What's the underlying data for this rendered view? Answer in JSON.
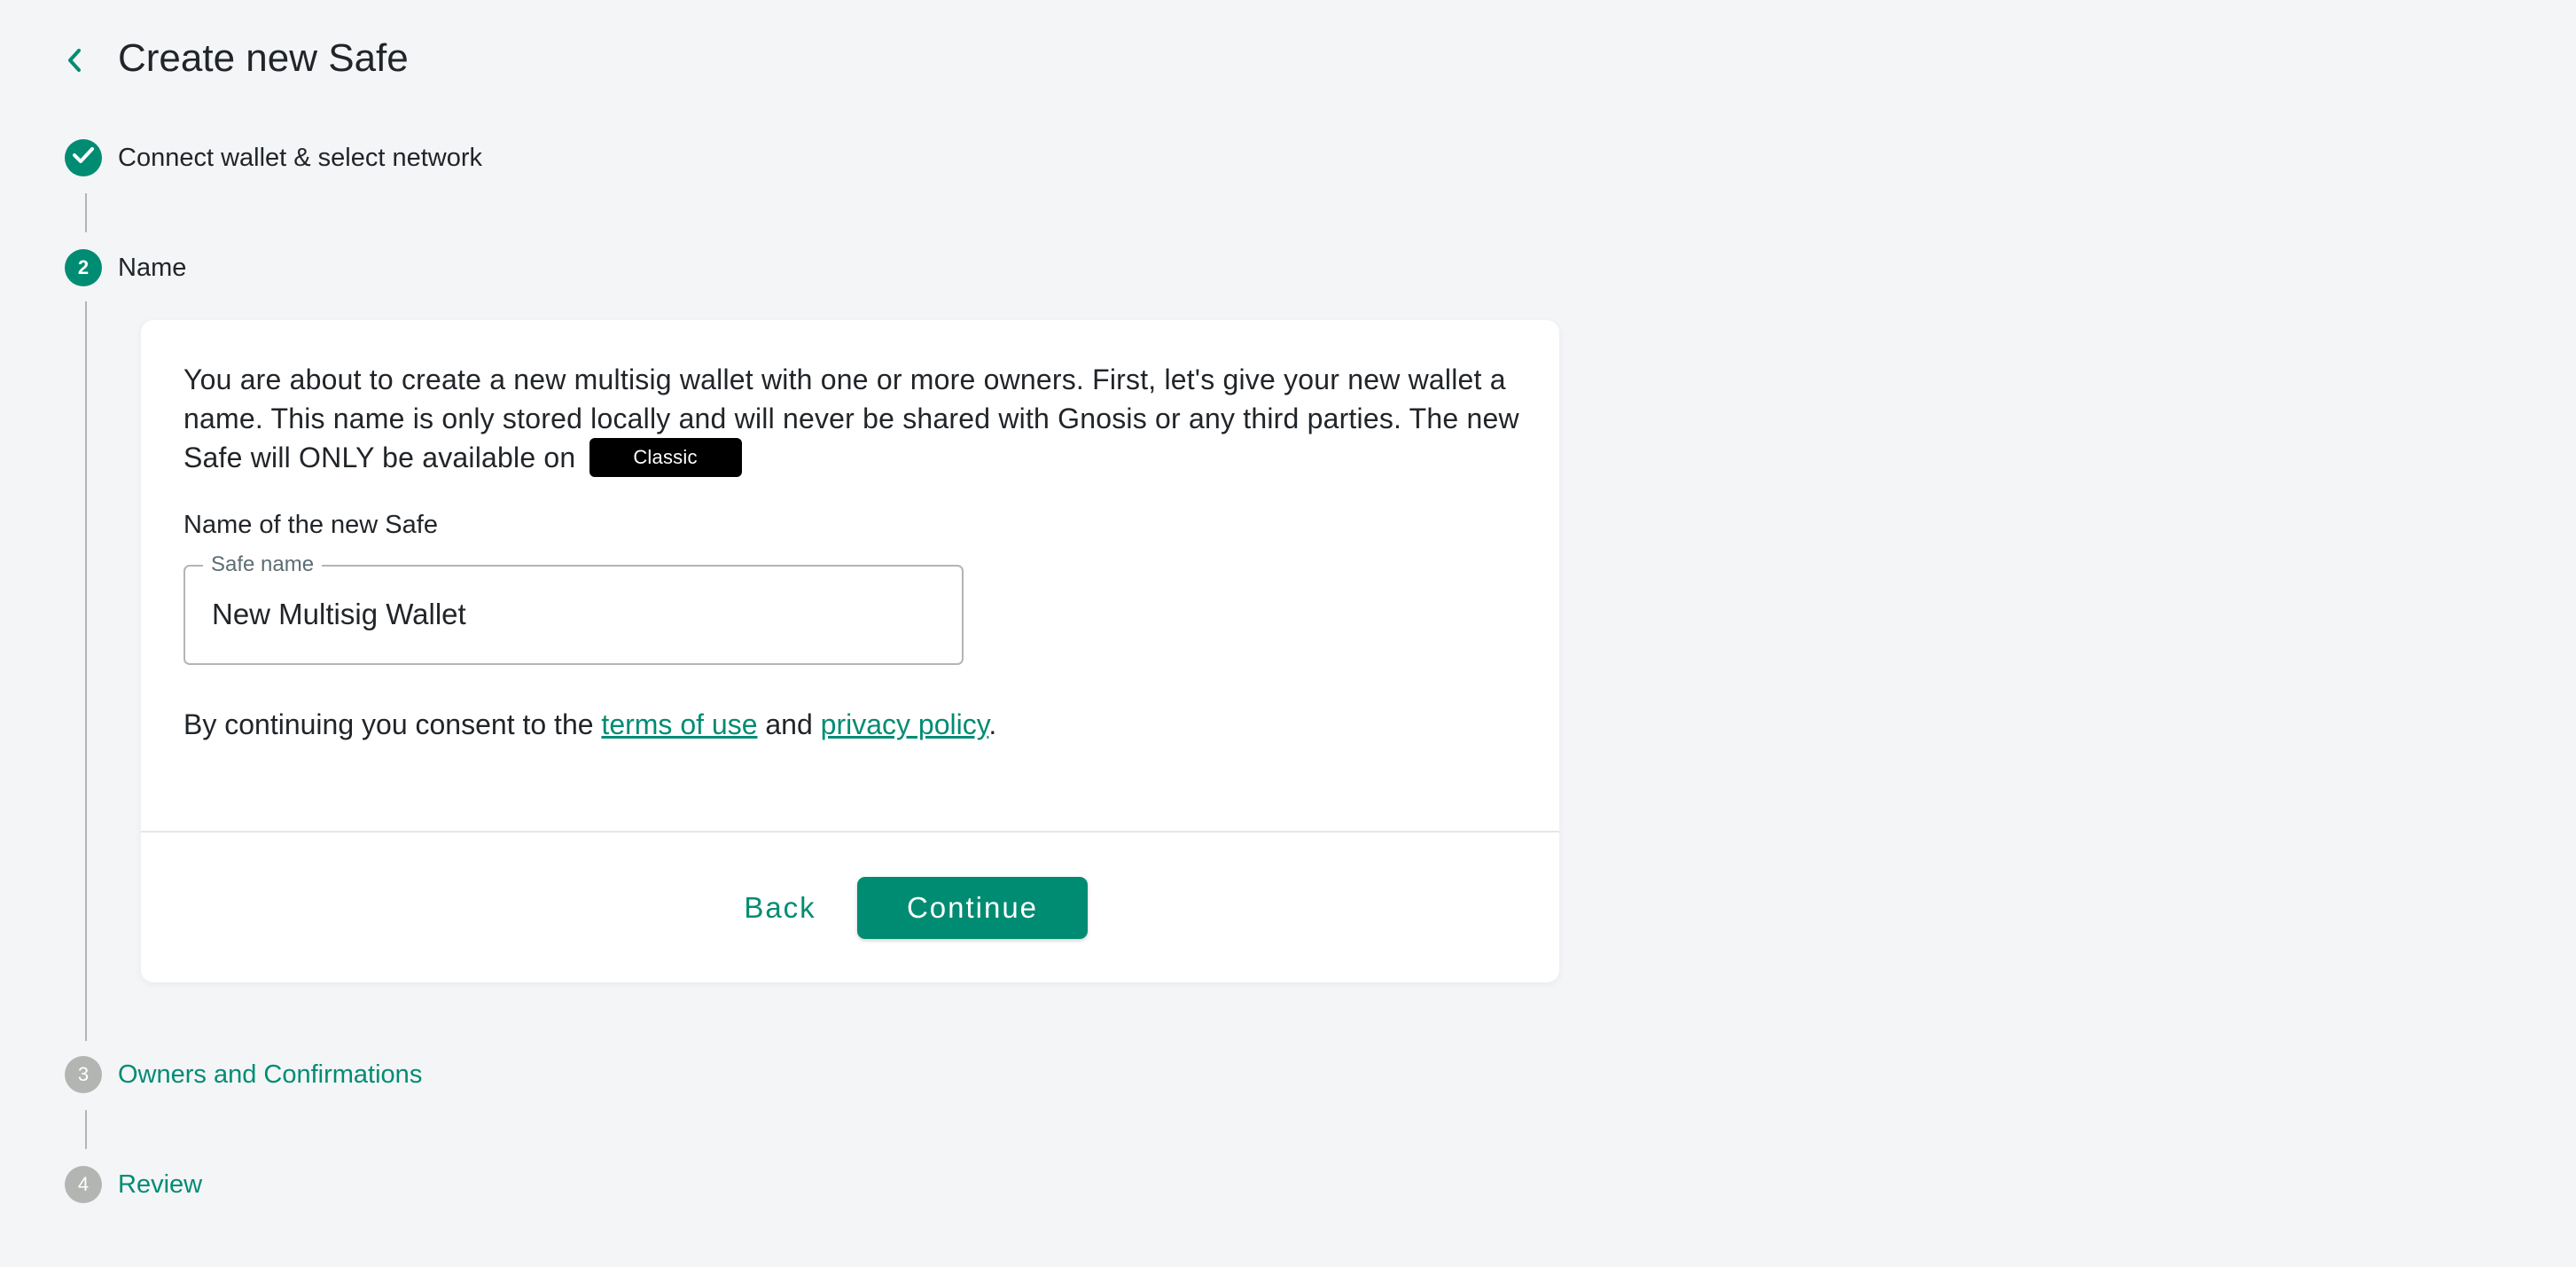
{
  "header": {
    "back_icon": "chevron-left-icon",
    "title": "Create new Safe"
  },
  "stepper": {
    "steps": [
      {
        "number": "",
        "label": "Connect wallet & select network",
        "status": "completed",
        "icon": "check-icon"
      },
      {
        "number": "2",
        "label": "Name",
        "status": "active"
      },
      {
        "number": "3",
        "label": "Owners and Confirmations",
        "status": "pending"
      },
      {
        "number": "4",
        "label": "Review",
        "status": "pending"
      }
    ]
  },
  "card": {
    "intro_text": "You are about to create a new multisig wallet with one or more owners. First, let's give your new wallet a name. This name is only stored locally and will never be shared with Gnosis or any third parties. The new Safe will ONLY be available on",
    "network_badge": "Classic",
    "field_title": "Name of the new Safe",
    "input": {
      "label": "Safe name",
      "value": "New Multisig Wallet"
    },
    "consent": {
      "prefix": "By continuing you consent to the",
      "terms_link": "terms of use",
      "middle": "and",
      "privacy_link": "privacy policy",
      "suffix": "."
    },
    "buttons": {
      "back": "Back",
      "continue": "Continue"
    }
  },
  "colors": {
    "primary": "#008c73",
    "pending": "#b2b5b2",
    "background": "#f4f5f7",
    "badge": "#000000"
  }
}
